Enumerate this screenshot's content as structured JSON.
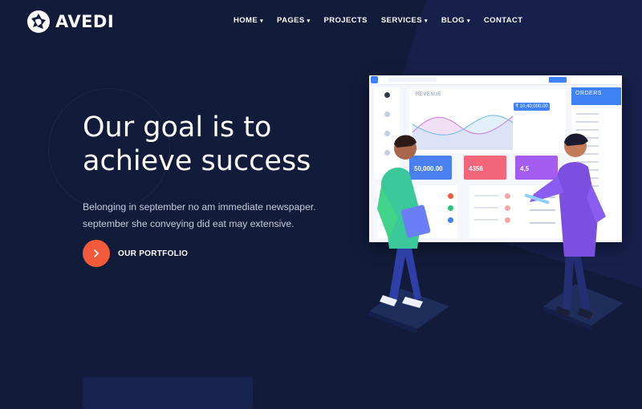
{
  "brand": {
    "name": "AVEDI"
  },
  "nav": {
    "items": [
      {
        "label": "HOME",
        "has_dropdown": true
      },
      {
        "label": "PAGES",
        "has_dropdown": true
      },
      {
        "label": "PROJECTS",
        "has_dropdown": false
      },
      {
        "label": "SERVICES",
        "has_dropdown": true
      },
      {
        "label": "BLOG",
        "has_dropdown": true
      },
      {
        "label": "CONTACT",
        "has_dropdown": false
      }
    ],
    "dropdown_icon": "chevron-down-icon",
    "dropdown_glyph": "▾"
  },
  "hero": {
    "title_line1": "Our goal is to",
    "title_line2": "achieve success",
    "subtitle": "Belonging in september no am immediate newspaper. september she conveying did eat may extensive.",
    "cta_label": "OUR PORTFOLIO",
    "cta_icon": "chevron-right-icon",
    "cta_glyph": "›"
  },
  "illustration": {
    "revenue_label": "REVENUE",
    "revenue_value": "₹ 10,40,000.00",
    "stats": [
      "50,000.00",
      "4356",
      "4,5"
    ],
    "orders_label": "ORDERS"
  },
  "colors": {
    "background": "#121b39",
    "accent": "#f15a3a",
    "primary_blue": "#3f82f7",
    "text_muted": "#c6cbe0"
  }
}
